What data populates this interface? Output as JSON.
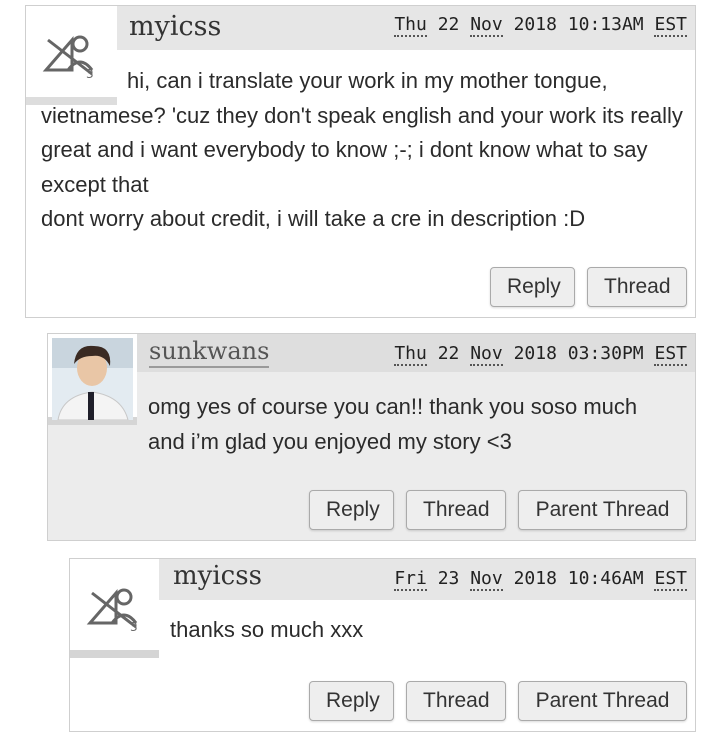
{
  "comments": [
    {
      "username": "myicss",
      "avatar_icon": "default-userpic-icon",
      "date": {
        "weekday": "Thu",
        "day": "22",
        "month": "Nov",
        "year": "2018",
        "time": "10:13AM",
        "tz": "EST"
      },
      "lines": [
        "hi, can i translate your work in my mother tongue, vietnamese? 'cuz they don't speak english and your work its really great and i want everybody to know ;-; i dont know what to say except that",
        "dont worry about credit, i will take a cre in description :D"
      ],
      "actions": {
        "reply": "Reply",
        "thread": "Thread"
      }
    },
    {
      "username": "sunkwans",
      "avatar_icon": "user-photo",
      "date": {
        "weekday": "Thu",
        "day": "22",
        "month": "Nov",
        "year": "2018",
        "time": "03:30PM",
        "tz": "EST"
      },
      "lines": [
        "omg yes of course you can!! thank you soso much",
        "and i’m glad you enjoyed my story <3"
      ],
      "actions": {
        "reply": "Reply",
        "thread": "Thread",
        "parent": "Parent Thread"
      }
    },
    {
      "username": "myicss",
      "avatar_icon": "default-userpic-icon",
      "date": {
        "weekday": "Fri",
        "day": "23",
        "month": "Nov",
        "year": "2018",
        "time": "10:46AM",
        "tz": "EST"
      },
      "lines": [
        "thanks so much xxx"
      ],
      "actions": {
        "reply": "Reply",
        "thread": "Thread",
        "parent": "Parent Thread"
      }
    }
  ],
  "colors": {
    "header_bg": "#e6e6e6",
    "nested_bg": "#ececec",
    "button_bg": "#eeeeee"
  }
}
